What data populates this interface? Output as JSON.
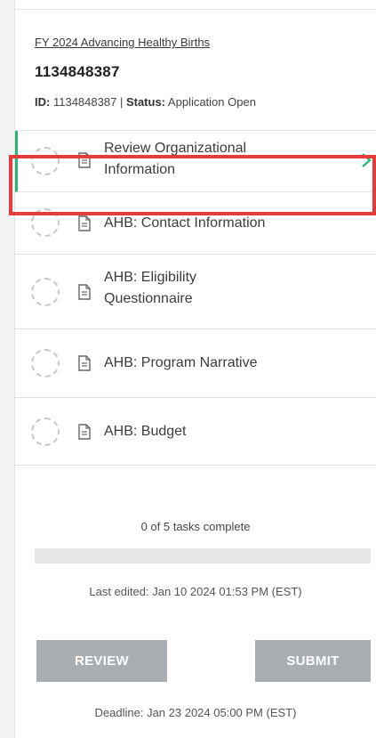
{
  "header": {
    "program_link": "FY 2024 Advancing Healthy Births",
    "application_number": "1134848387",
    "id_label": "ID:",
    "id_value": "1134848387",
    "separator": "|",
    "status_label": "Status:",
    "status_value": "Application Open"
  },
  "tasks": [
    {
      "label_line1": "Review Organizational",
      "label_line2": "Information",
      "active": true
    },
    {
      "label_line1": "AHB: Contact Information",
      "label_line2": ""
    },
    {
      "label_line1": "AHB: Eligibility",
      "label_line2": "Questionnaire"
    },
    {
      "label_line1": "AHB: Program Narrative",
      "label_line2": ""
    },
    {
      "label_line1": "AHB: Budget",
      "label_line2": ""
    }
  ],
  "progress": {
    "text": "0 of 5 tasks complete",
    "fraction": 0
  },
  "last_edited": "Last edited: Jan 10 2024 01:53 PM (EST)",
  "buttons": {
    "review": "REVIEW",
    "submit": "SUBMIT"
  },
  "deadline": "Deadline: Jan 23 2024 05:00 PM (EST)",
  "colors": {
    "accent": "#2bb673",
    "highlight": "#e53b3b",
    "button": "#a9aeb2"
  },
  "icons": {
    "task_status": "dashed-circle-icon",
    "task_doc": "document-icon",
    "active_chevron": "chevron-right-icon"
  }
}
